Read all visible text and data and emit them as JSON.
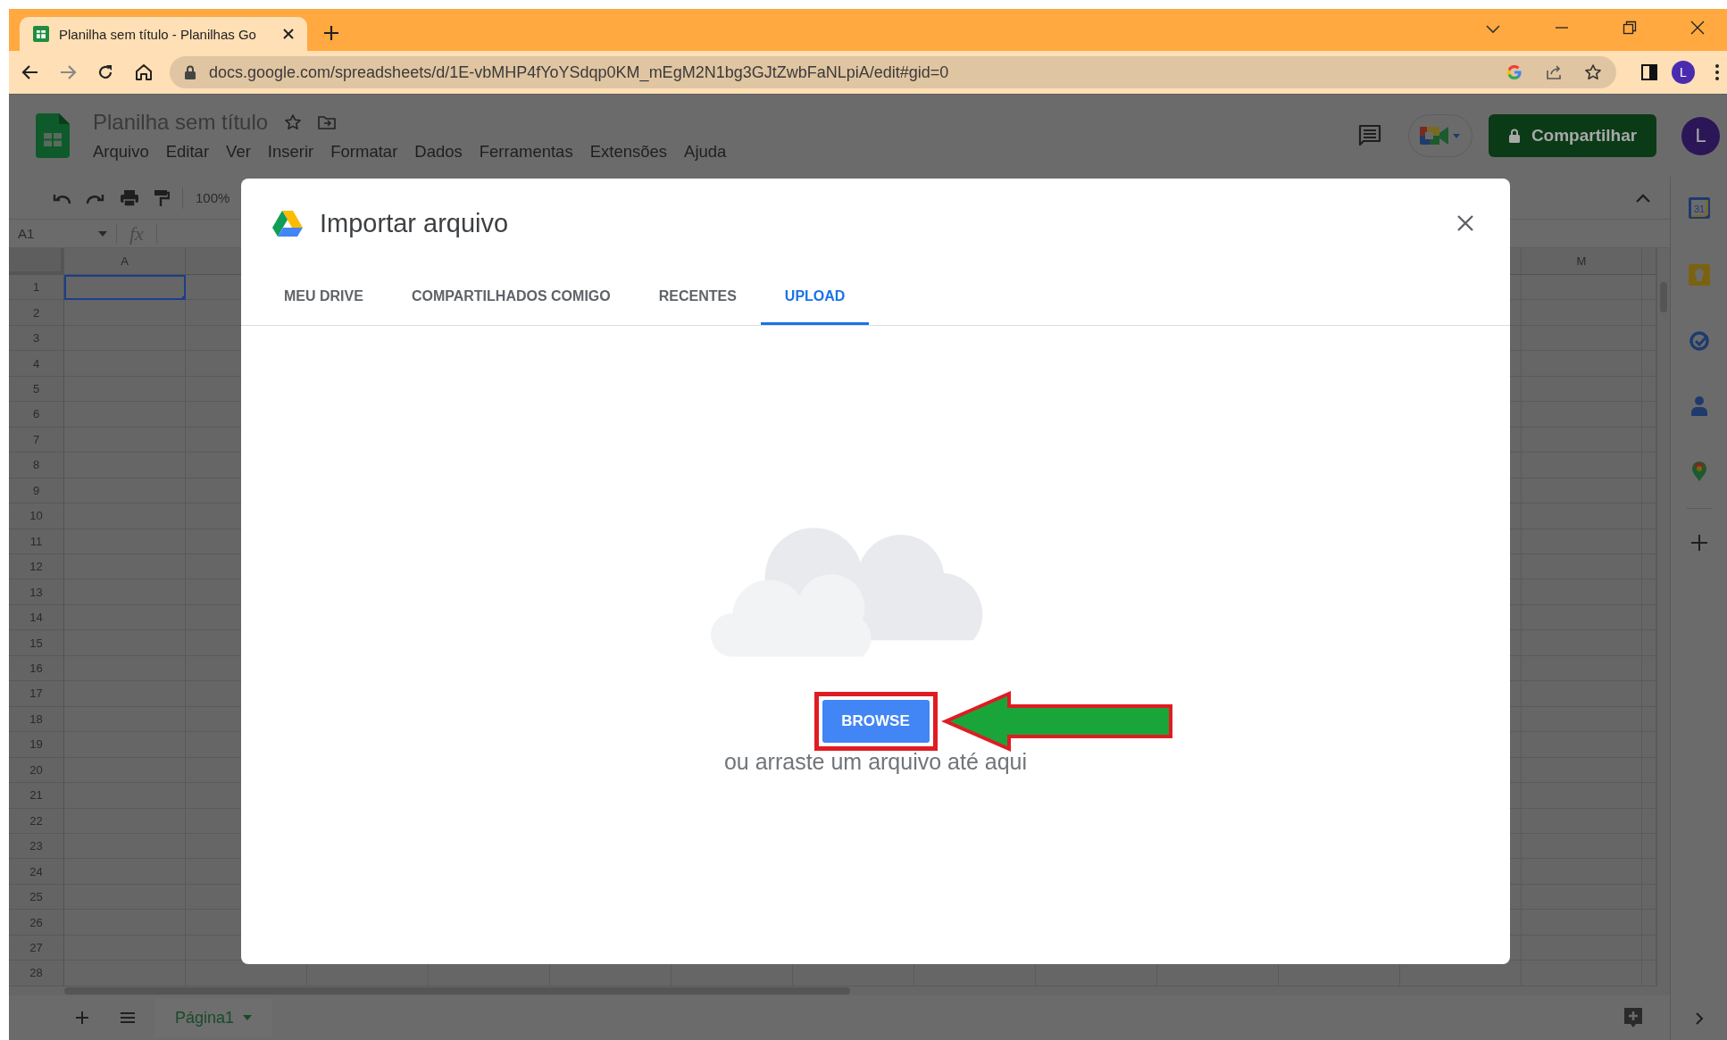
{
  "browser": {
    "tab_title": "Planilha sem título - Planilhas Go",
    "url": "docs.google.com/spreadsheets/d/1E-vbMHP4fYoYSdqp0KM_mEgM2N1bg3GJtZwbFaNLpiA/edit#gid=0",
    "profile_initial": "L"
  },
  "sheets": {
    "title": "Planilha sem título",
    "menu": [
      "Arquivo",
      "Editar",
      "Ver",
      "Inserir",
      "Formatar",
      "Dados",
      "Ferramentas",
      "Extensões",
      "Ajuda"
    ],
    "share_button": "Compartilhar",
    "avatar_initial": "L",
    "zoom": "100%",
    "name_box": "A1",
    "formula_label": "fx",
    "columns": [
      {
        "label": "A"
      },
      {
        "label": "M"
      }
    ],
    "rows": [
      "1",
      "2",
      "3",
      "4",
      "5",
      "6",
      "7",
      "8",
      "9",
      "10",
      "11",
      "12",
      "13",
      "14",
      "15",
      "16",
      "17",
      "18",
      "19",
      "20",
      "21",
      "22",
      "23",
      "24",
      "25",
      "26",
      "27",
      "28"
    ],
    "sheet_tabs": [
      {
        "label": "Página1",
        "selected": true
      }
    ],
    "calendar_day": "31"
  },
  "dialog": {
    "title": "Importar arquivo",
    "tabs": [
      {
        "label": "MEU DRIVE",
        "selected": false
      },
      {
        "label": "COMPARTILHADOS COMIGO",
        "selected": false
      },
      {
        "label": "RECENTES",
        "selected": false
      },
      {
        "label": "UPLOAD",
        "selected": true
      }
    ],
    "browse_button": "BROWSE",
    "drop_hint": "ou arraste um arquivo até aqui"
  }
}
